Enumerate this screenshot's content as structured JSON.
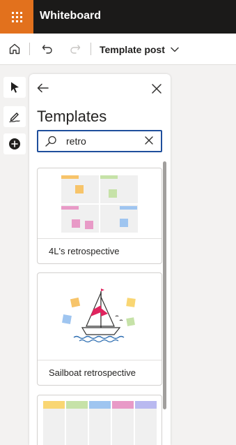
{
  "app": {
    "title": "Whiteboard"
  },
  "toolbar": {
    "document_title": "Template post"
  },
  "rail": {
    "tools": [
      "select-tool",
      "pen-tool",
      "add-tool"
    ]
  },
  "panel": {
    "title": "Templates",
    "search": {
      "value": "retro"
    },
    "templates": [
      {
        "label": "4L's retrospective"
      },
      {
        "label": "Sailboat retrospective"
      },
      {
        "label": ""
      }
    ]
  },
  "colors": {
    "topbar": "#1b1a19",
    "waffle": "#e2711d",
    "search_border": "#1f4f9c",
    "note_yellow": "#f9d673",
    "note_green": "#c6e2a8",
    "note_pink": "#e89ac7",
    "note_blue": "#9fc5f0",
    "note_orange": "#f7c46a"
  }
}
